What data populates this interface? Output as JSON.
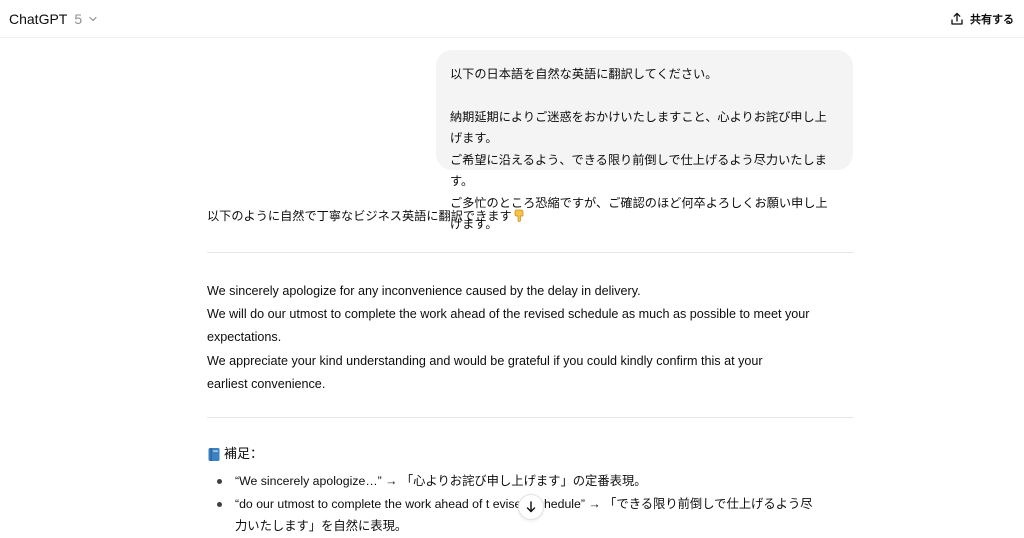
{
  "header": {
    "model_name": "ChatGPT",
    "model_version": "5",
    "share_label": "共有する"
  },
  "user_message": {
    "line1": "以下の日本語を自然な英語に翻訳してください。",
    "line2": "納期延期によりご迷惑をおかけいたしますこと、心よりお詫び申し上げます。",
    "line3": "ご希望に沿えるよう、できる限り前倒しで仕上げるよう尽力いたします。",
    "line4": "ご多忙のところ恐縮ですが、ご確認のほど何卒よろしくお願い申し上げます。"
  },
  "assistant": {
    "intro": "以下のように自然で丁寧なビジネス英語に翻訳できます",
    "translation": {
      "line1": "We sincerely apologize for any inconvenience caused by the delay in delivery.",
      "line2": "We will do our utmost to complete the work ahead of the revised schedule as much as possible to meet your",
      "line3": "expectations.",
      "line4": "We appreciate your kind understanding and would be grateful if you could kindly confirm this at your",
      "line5": "earliest convenience."
    },
    "note_title": "補足：",
    "notes": [
      {
        "text": "“We sincerely apologize…” → 「心よりお詫び申し上げます」の定番表現。"
      },
      {
        "line1": "“do our utmost to complete the work ahead of t    evised schedule” → 「できる限り前倒しで仕上げるよう尽",
        "line2": "力いたします」を自然に表現。"
      }
    ]
  },
  "icons": {
    "chevron": "chevron-down-icon",
    "share": "share-upload-icon",
    "point": "pointing-down-emoji-icon",
    "book": "blue-book-icon",
    "scroll": "arrow-down-icon"
  },
  "colors": {
    "bubble_bg": "#f4f4f4",
    "divider": "#e6e6e6",
    "muted_text": "#8f8f8f",
    "emoji_yellow": "#f7c348",
    "book_blue": "#3b82c4"
  }
}
